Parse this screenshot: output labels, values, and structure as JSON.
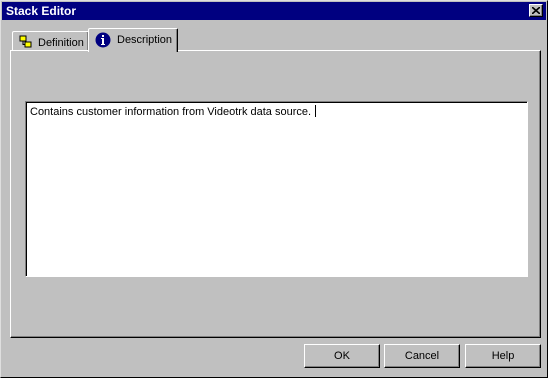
{
  "window": {
    "title": "Stack Editor"
  },
  "tabs": [
    {
      "label": "Definition",
      "icon": "definition-icon",
      "active": false
    },
    {
      "label": "Description",
      "icon": "info-icon",
      "active": true
    }
  ],
  "description": {
    "text": "Contains customer information from Videotrk data source."
  },
  "buttons": {
    "ok": "OK",
    "cancel": "Cancel",
    "help": "Help"
  },
  "colors": {
    "titlebar": "#000080",
    "face": "#c0c0c0",
    "info_icon": "#000080"
  }
}
